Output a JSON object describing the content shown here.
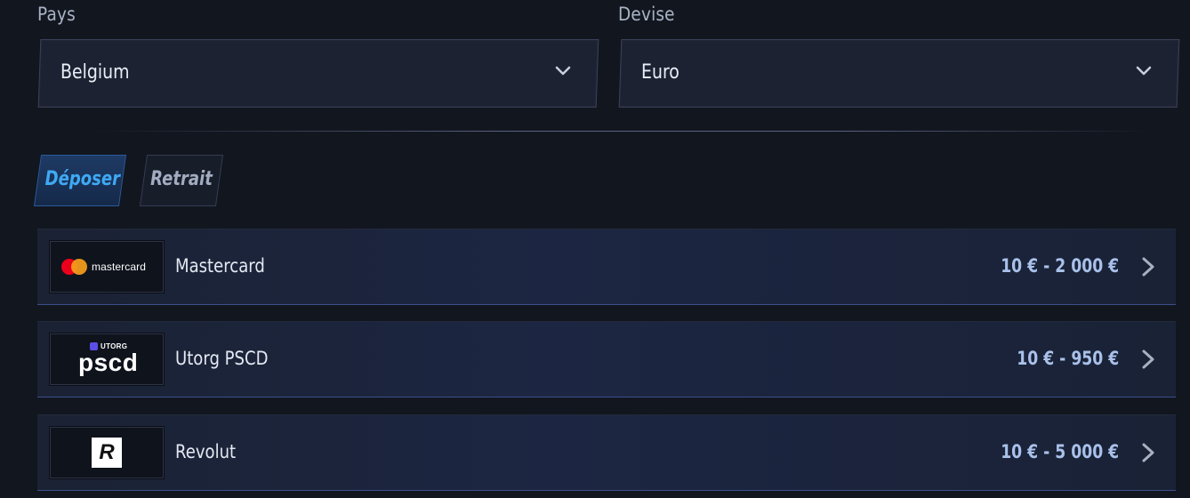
{
  "filters": {
    "country": {
      "label": "Pays",
      "value": "Belgium"
    },
    "currency": {
      "label": "Devise",
      "value": "Euro"
    }
  },
  "tabs": [
    {
      "label": "Déposer",
      "active": true
    },
    {
      "label": "Retrait",
      "active": false
    }
  ],
  "methods": [
    {
      "logo": "mastercard-logo",
      "logo_text": "mastercard",
      "name": "Mastercard",
      "range": "10 € - 2 000 €"
    },
    {
      "logo": "utorg-pscd-logo",
      "logo_text_small": "UTORG",
      "logo_text_main": "pscd",
      "name": "Utorg PSCD",
      "range": "10 € - 950 €"
    },
    {
      "logo": "revolut-logo",
      "logo_text": "R",
      "name": "Revolut",
      "range": "10 € - 5 000 €"
    }
  ],
  "colors": {
    "background": "#12161f",
    "accent": "#3fa9f5",
    "range_text": "#a9c1ea",
    "mastercard_red": "#eb001b",
    "mastercard_orange": "#f79e1b"
  },
  "icons": {
    "select_arrow": "chevron-down-icon",
    "row_arrow": "chevron-right-icon"
  }
}
